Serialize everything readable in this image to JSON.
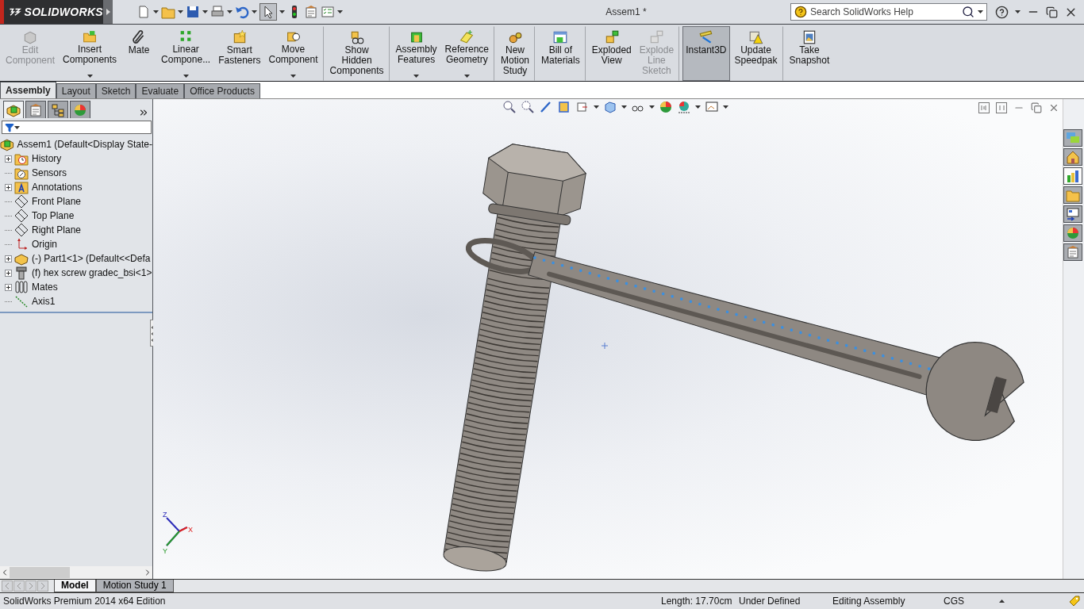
{
  "app": {
    "logo": "SOLIDWORKS",
    "title": "Assem1 *"
  },
  "search": {
    "placeholder": "Search SolidWorks Help"
  },
  "ribbon": [
    {
      "kind": "edit",
      "lines": [
        "Edit",
        "Component"
      ],
      "disabled": true,
      "dropdown": false,
      "pressed": false,
      "separator_after": false
    },
    {
      "kind": "insert",
      "lines": [
        "Insert",
        "Components"
      ],
      "disabled": false,
      "dropdown": true,
      "pressed": false,
      "separator_after": false
    },
    {
      "kind": "mate",
      "lines": [
        "Mate"
      ],
      "disabled": false,
      "dropdown": false,
      "pressed": false,
      "separator_after": false
    },
    {
      "kind": "pattern",
      "lines": [
        "Linear",
        "Compone..."
      ],
      "disabled": false,
      "dropdown": true,
      "pressed": false,
      "separator_after": false
    },
    {
      "kind": "fasteners",
      "lines": [
        "Smart",
        "Fasteners"
      ],
      "disabled": false,
      "dropdown": false,
      "pressed": false,
      "separator_after": false
    },
    {
      "kind": "move",
      "lines": [
        "Move",
        "Component"
      ],
      "disabled": false,
      "dropdown": true,
      "pressed": false,
      "separator_after": true
    },
    {
      "kind": "hidden",
      "lines": [
        "Show",
        "Hidden",
        "Components"
      ],
      "disabled": false,
      "dropdown": false,
      "pressed": false,
      "separator_after": true
    },
    {
      "kind": "features",
      "lines": [
        "Assembly",
        "Features"
      ],
      "disabled": false,
      "dropdown": true,
      "pressed": false,
      "separator_after": false
    },
    {
      "kind": "reference",
      "lines": [
        "Reference",
        "Geometry"
      ],
      "disabled": false,
      "dropdown": true,
      "pressed": false,
      "separator_after": true
    },
    {
      "kind": "motion",
      "lines": [
        "New",
        "Motion",
        "Study"
      ],
      "disabled": false,
      "dropdown": false,
      "pressed": false,
      "separator_after": true
    },
    {
      "kind": "bom",
      "lines": [
        "Bill of",
        "Materials"
      ],
      "disabled": false,
      "dropdown": false,
      "pressed": false,
      "separator_after": true
    },
    {
      "kind": "exploded",
      "lines": [
        "Exploded",
        "View"
      ],
      "disabled": false,
      "dropdown": false,
      "pressed": false,
      "separator_after": false
    },
    {
      "kind": "explodeline",
      "lines": [
        "Explode",
        "Line",
        "Sketch"
      ],
      "disabled": true,
      "dropdown": false,
      "pressed": false,
      "separator_after": true
    },
    {
      "kind": "instant3d",
      "lines": [
        "Instant3D"
      ],
      "disabled": false,
      "dropdown": false,
      "pressed": true,
      "separator_after": false
    },
    {
      "kind": "speedpak",
      "lines": [
        "Update",
        "Speedpak"
      ],
      "disabled": false,
      "dropdown": false,
      "pressed": false,
      "separator_after": true
    },
    {
      "kind": "snapshot",
      "lines": [
        "Take",
        "Snapshot"
      ],
      "disabled": false,
      "dropdown": false,
      "pressed": false,
      "separator_after": false
    }
  ],
  "command_tabs": [
    {
      "label": "Assembly",
      "selected": true
    },
    {
      "label": "Layout",
      "selected": false
    },
    {
      "label": "Sketch",
      "selected": false
    },
    {
      "label": "Evaluate",
      "selected": false
    },
    {
      "label": "Office Products",
      "selected": false
    }
  ],
  "panel_tabs": [
    {
      "kind": "features",
      "selected": true
    },
    {
      "kind": "properties",
      "selected": false
    },
    {
      "kind": "configurations",
      "selected": false
    },
    {
      "kind": "display",
      "selected": false
    }
  ],
  "tree": {
    "label": "Assem1  (Default<Display State-",
    "kind": "assembly",
    "children": [
      {
        "label": "History",
        "kind": "history",
        "expandable": true
      },
      {
        "label": "Sensors",
        "kind": "sensors",
        "expandable": false
      },
      {
        "label": "Annotations",
        "kind": "annotations",
        "expandable": true
      },
      {
        "label": "Front Plane",
        "kind": "plane",
        "expandable": false
      },
      {
        "label": "Top Plane",
        "kind": "plane",
        "expandable": false
      },
      {
        "label": "Right Plane",
        "kind": "plane",
        "expandable": false
      },
      {
        "label": "Origin",
        "kind": "origin",
        "expandable": false
      },
      {
        "label": "(-) Part1<1> (Default<<Defa",
        "kind": "part",
        "expandable": true
      },
      {
        "label": "(f) hex screw gradec_bsi<1>",
        "kind": "screw",
        "expandable": true
      },
      {
        "label": "Mates",
        "kind": "mates",
        "expandable": true
      },
      {
        "label": "Axis1",
        "kind": "axis",
        "expandable": false
      }
    ]
  },
  "task_pane": [
    {
      "kind": "resources",
      "selected": false
    },
    {
      "kind": "home",
      "selected": false
    },
    {
      "kind": "library",
      "selected": true
    },
    {
      "kind": "folder",
      "selected": false
    },
    {
      "kind": "palette",
      "selected": false
    },
    {
      "kind": "appearances",
      "selected": false
    },
    {
      "kind": "properties",
      "selected": false
    }
  ],
  "triad_labels": [
    "Z",
    "Y",
    "X"
  ],
  "bottom_tabs": [
    {
      "label": "Model",
      "selected": true
    },
    {
      "label": "Motion Study 1",
      "selected": false
    }
  ],
  "status": {
    "edition": "SolidWorks Premium 2014 x64 Edition",
    "fields": [
      "Length: 17.70cm",
      "Under Defined",
      "Editing Assembly",
      "CGS"
    ]
  }
}
